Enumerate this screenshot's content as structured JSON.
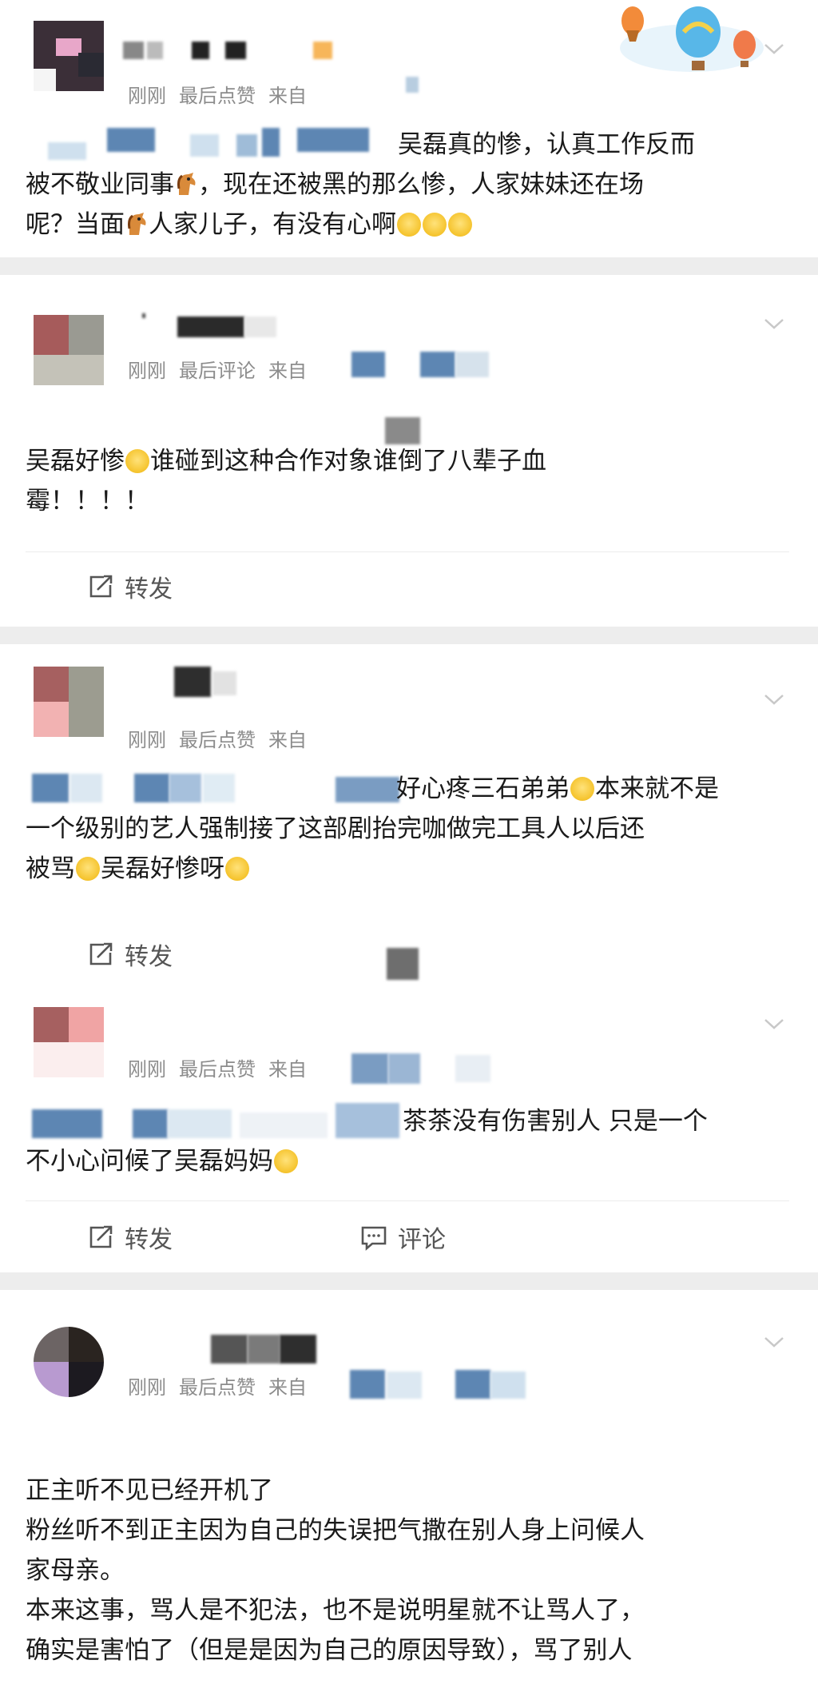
{
  "comments": [
    {
      "time": "刚刚",
      "kind": "最后点赞",
      "source": "来自",
      "lines": [
        "吴磊真的惨，认真工作反而",
        "被不敬业同事",
        "，现在还被黑的那么惨，人家妹妹还在场",
        "呢？当面",
        "人家儿子，有没有心啊"
      ]
    },
    {
      "time": "刚刚",
      "kind": "最后评论",
      "source": "来自",
      "lines": [
        "吴磊好惨",
        "谁碰到这种合作对象谁倒了八辈子血",
        "霉！！！！"
      ],
      "repost": "转发"
    },
    {
      "time": "刚刚",
      "kind": "最后点赞",
      "source": "来自",
      "lines": [
        "好心疼三石弟弟",
        "本来就不是",
        "一个级别的艺人强制接了这部剧抬完咖做完工具人以后还",
        "被骂",
        "吴磊好惨呀"
      ],
      "repost": "转发"
    },
    {
      "time": "刚刚",
      "kind": "最后点赞",
      "source": "来自",
      "lines": [
        "茶茶没有伤害别人 只是一个",
        "不小心问候了吴磊妈妈"
      ],
      "repost": "转发",
      "comment": "评论"
    },
    {
      "time": "刚刚",
      "kind": "最后点赞",
      "source": "来自",
      "lines": [
        "正主听不见已经开机了",
        "粉丝听不到正主因为自己的失误把气撒在别人身上问候人",
        "家母亲。",
        "本来这事，骂人是不犯法，也不是说明星就不让骂人了，",
        "确实是害怕了（但是是因为自己的原因导致），骂了别人"
      ]
    }
  ],
  "icons": {
    "chevron": "chevron-down-icon",
    "repost": "repost-icon",
    "comment": "comment-icon",
    "emoji_cry": "crying-face-icon",
    "emoji_sad": "sad-face-icon",
    "emoji_horse": "horse-emoji-icon",
    "balloons": "hot-air-balloon-icon"
  },
  "colors": {
    "meta_text": "#8c8c8c",
    "body_text": "#1a1a1a",
    "separator": "#ededed"
  }
}
